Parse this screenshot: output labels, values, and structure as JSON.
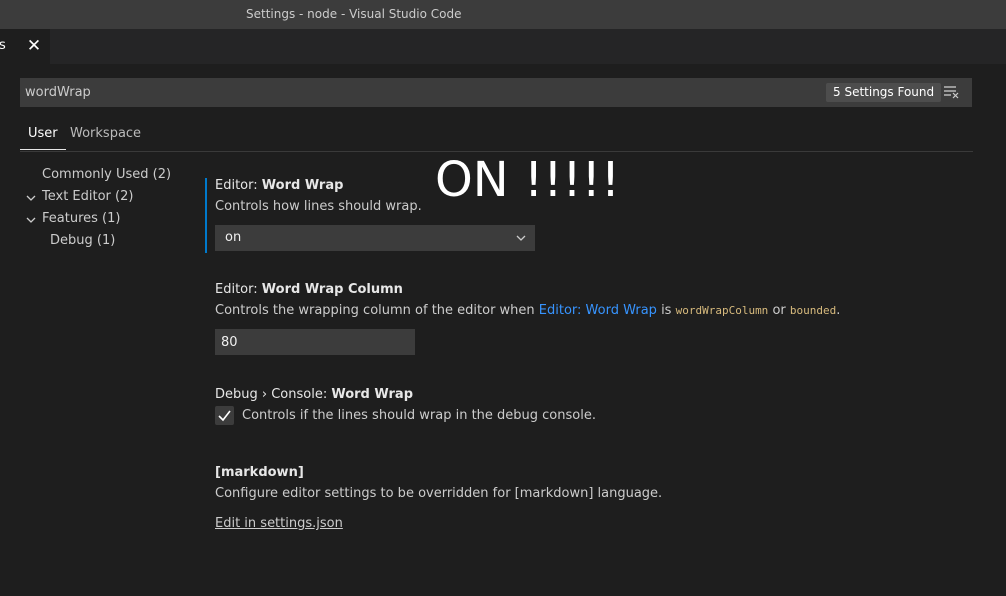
{
  "window": {
    "title": "Settings - node - Visual Studio Code"
  },
  "tab": {
    "label": "s",
    "close_glyph": "✕"
  },
  "search": {
    "value": "wordWrap",
    "results": "5 Settings Found",
    "clear_icon": "clear-filter-icon"
  },
  "scopes": {
    "user": "User",
    "workspace": "Workspace"
  },
  "toc": [
    {
      "label": "Commonly Used (2)"
    },
    {
      "label": "Text Editor (2)"
    },
    {
      "label": "Features (1)"
    },
    {
      "label": "Debug (1)"
    }
  ],
  "overlay_text": "ON !!!!!",
  "settings": {
    "word_wrap": {
      "category": "Editor: ",
      "name": "Word Wrap",
      "description": "Controls how lines should wrap.",
      "value": "on"
    },
    "word_wrap_column": {
      "category": "Editor: ",
      "name": "Word Wrap Column",
      "desc_before": "Controls the wrapping column of the editor when ",
      "desc_link": "Editor: Word Wrap",
      "desc_mid": " is ",
      "code1": "wordWrapColumn",
      "desc_or": " or ",
      "code2": "bounded",
      "desc_end": ".",
      "value": "80"
    },
    "debug_console": {
      "category": "Debug › Console: ",
      "name": "Word Wrap",
      "description": "Controls if the lines should wrap in the debug console.",
      "checked": true
    },
    "markdown": {
      "name": "[markdown]",
      "description": "Configure editor settings to be overridden for [markdown] language.",
      "link": "Edit in settings.json"
    }
  },
  "colors": {
    "accent": "#007acc",
    "link": "#3794ff",
    "code": "#d7ba7d",
    "background": "#1e1e1e"
  }
}
